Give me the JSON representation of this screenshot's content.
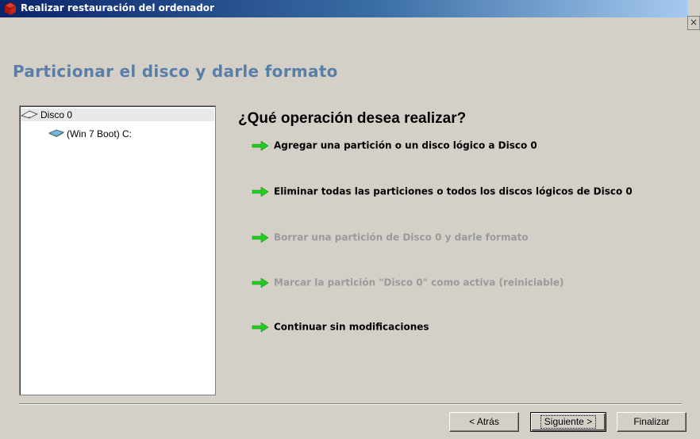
{
  "window": {
    "title": "Realizar restauración del ordenador",
    "close_label": ""
  },
  "page": {
    "title": "Particionar el disco y darle formato"
  },
  "tree": {
    "root_label": "Disco 0",
    "children": [
      {
        "label": "(Win 7 Boot) C:"
      }
    ]
  },
  "main": {
    "question": "¿Qué operación desea realizar?",
    "options": [
      {
        "label": "Agregar una partición o un disco lógico a Disco 0",
        "enabled": true
      },
      {
        "label": "Eliminar todas las particiones o todos los discos lógicos de Disco 0",
        "enabled": true
      },
      {
        "label": "Borrar una partición de Disco 0 y darle formato",
        "enabled": false
      },
      {
        "label": "Marcar la partición \"Disco 0\" como activa (reiniciable)",
        "enabled": false
      },
      {
        "label": "Continuar sin modificaciones",
        "enabled": true
      }
    ]
  },
  "buttons": {
    "back": "< Atrás",
    "next": "Siguiente >",
    "finish": "Finalizar"
  },
  "colors": {
    "title_accent": "#5a7fa6",
    "arrow_green": "#22cc22",
    "disabled_text": "#9a9a9a"
  }
}
